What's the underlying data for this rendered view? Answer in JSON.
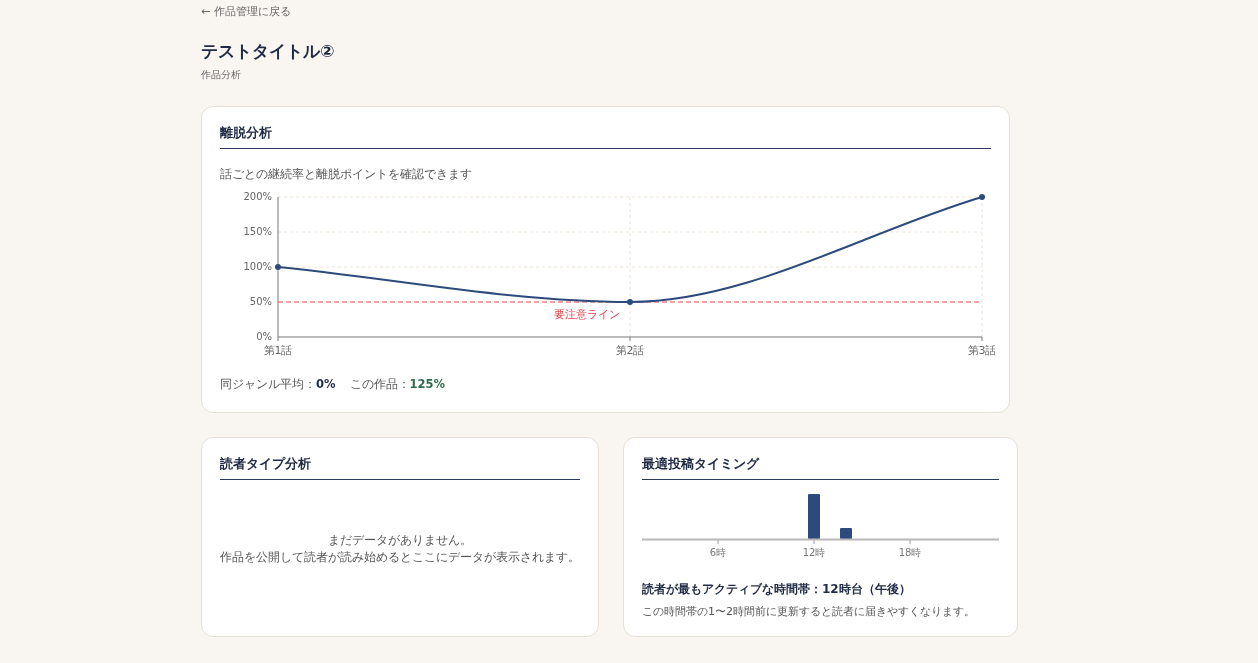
{
  "back_link": "← 作品管理に戻る",
  "title": "テストタイトル②",
  "subtitle": "作品分析",
  "dropoff": {
    "heading": "離脱分析",
    "description": "話ごとの継続率と離脱ポイントを確認できます",
    "chart_data": {
      "type": "line",
      "categories": [
        "第1話",
        "第2話",
        "第3話"
      ],
      "series": [
        {
          "color": "#2c4a7c",
          "marker": "circle",
          "values": [
            100,
            50,
            200
          ]
        }
      ],
      "grid": true,
      "ylim": [
        0,
        200
      ],
      "yticks": [
        {
          "value": 0,
          "label": "0%"
        },
        {
          "value": 50,
          "label": "50%"
        },
        {
          "value": 100,
          "label": "100%"
        },
        {
          "value": 150,
          "label": "150%"
        },
        {
          "value": 200,
          "label": "200%"
        }
      ],
      "ref_lines": [
        {
          "axis": "y",
          "value": 50,
          "label": "要注意ライン",
          "color": "#e8434f"
        }
      ]
    },
    "stats": [
      "同ジャンル平均：**0%**",
      "この作品：**125%**"
    ]
  },
  "reader_types": {
    "heading": "読者タイプ分析",
    "empty_message": [
      "まだデータがありません。",
      "作品を公開して読者が読み始めるとここにデータが表示されます。"
    ]
  },
  "timing": {
    "heading": "最適投稿タイミング",
    "hour_ticks": [
      "6時",
      "12時",
      "18時"
    ],
    "summary": "読者が最もアクティブな時間帯：12時台（午後）",
    "hint": "この時間帯の1〜2時間前に更新すると読者に届きやすくなります。"
  }
}
